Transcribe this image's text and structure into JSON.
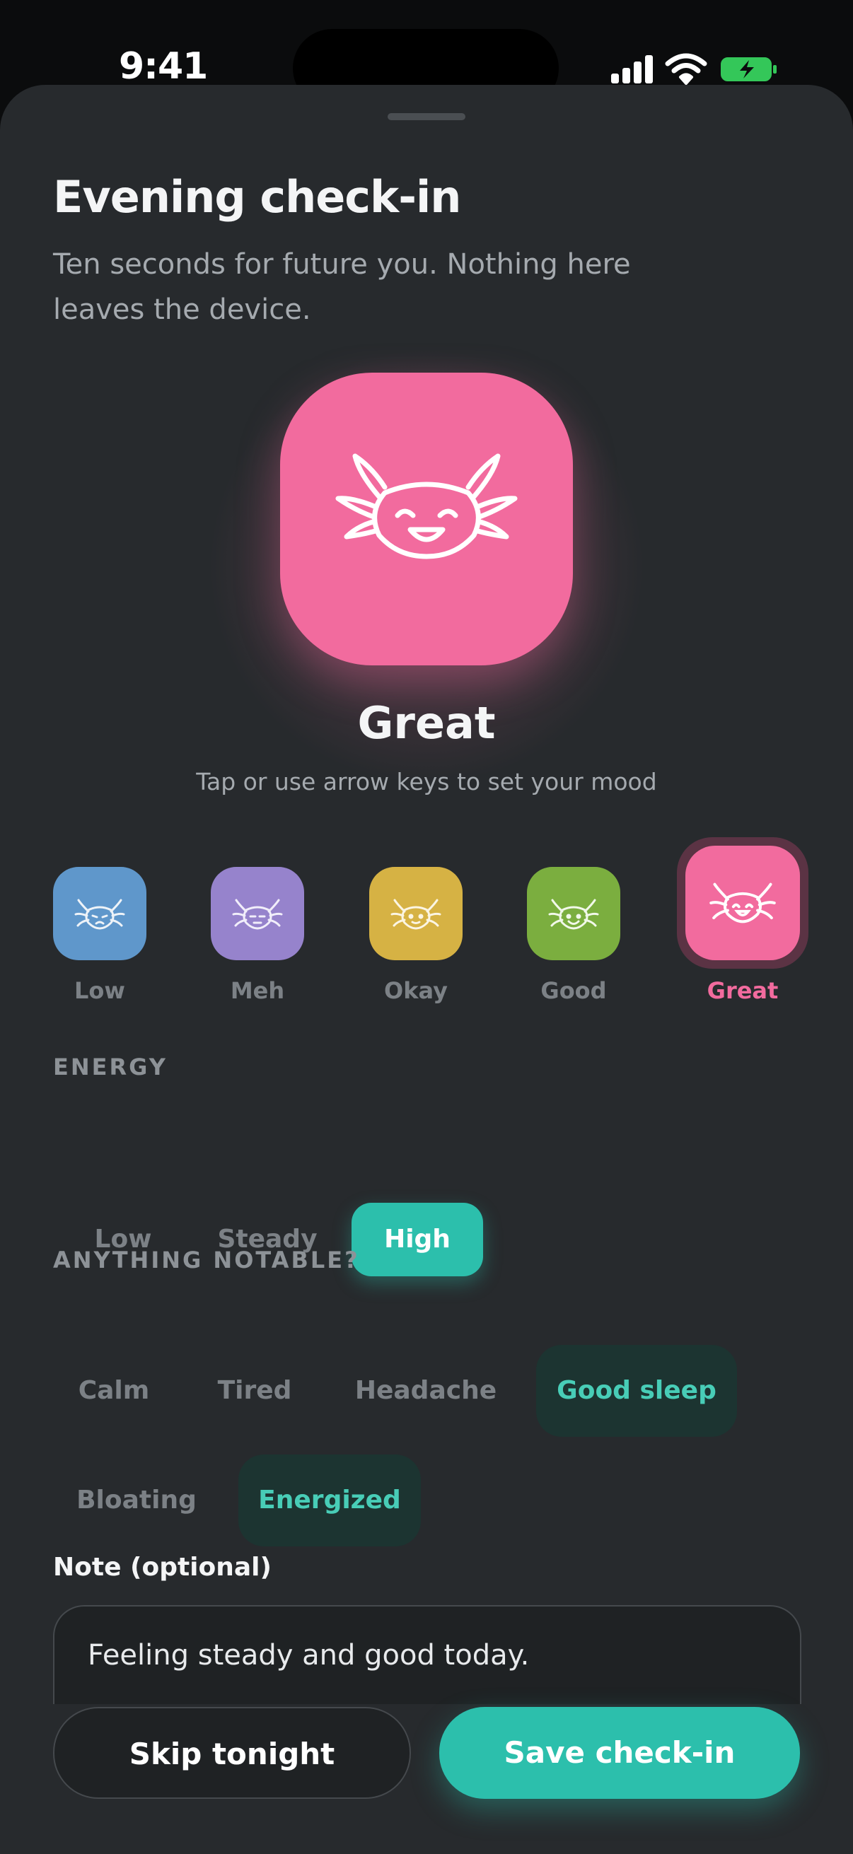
{
  "status_bar": {
    "time": "9:41",
    "icons": [
      "cellular-signal-icon",
      "wifi-icon",
      "battery-charging-icon"
    ]
  },
  "sheet": {
    "title": "Evening check-in",
    "subtitle": "Ten seconds for future you. Nothing here leaves the device."
  },
  "mood": {
    "selected": "Great",
    "selected_color": "#f26b9e",
    "hint": "Tap or use arrow keys to set your mood",
    "options": [
      {
        "label": "Low",
        "color": "#5f97cb",
        "icon": "axolotl-sad-icon"
      },
      {
        "label": "Meh",
        "color": "#9683cc",
        "icon": "axolotl-meh-icon"
      },
      {
        "label": "Okay",
        "color": "#d6b244",
        "icon": "axolotl-okay-icon"
      },
      {
        "label": "Good",
        "color": "#7bae3f",
        "icon": "axolotl-good-icon"
      },
      {
        "label": "Great",
        "color": "#f26b9e",
        "icon": "axolotl-great-icon"
      }
    ]
  },
  "energy": {
    "label": "ENERGY",
    "options": [
      "Low",
      "Steady",
      "High"
    ],
    "selected": "High",
    "accent": "#2cbfac"
  },
  "notable": {
    "label": "ANYTHING NOTABLE?",
    "tags": [
      {
        "label": "Calm",
        "selected": false
      },
      {
        "label": "Tired",
        "selected": false
      },
      {
        "label": "Headache",
        "selected": false
      },
      {
        "label": "Good sleep",
        "selected": true
      },
      {
        "label": "Bloating",
        "selected": false
      },
      {
        "label": "Energized",
        "selected": true
      }
    ]
  },
  "note": {
    "label": "Note (optional)",
    "value": "Feeling steady and good today."
  },
  "actions": {
    "skip_label": "Skip tonight",
    "save_label": "Save check-in"
  }
}
